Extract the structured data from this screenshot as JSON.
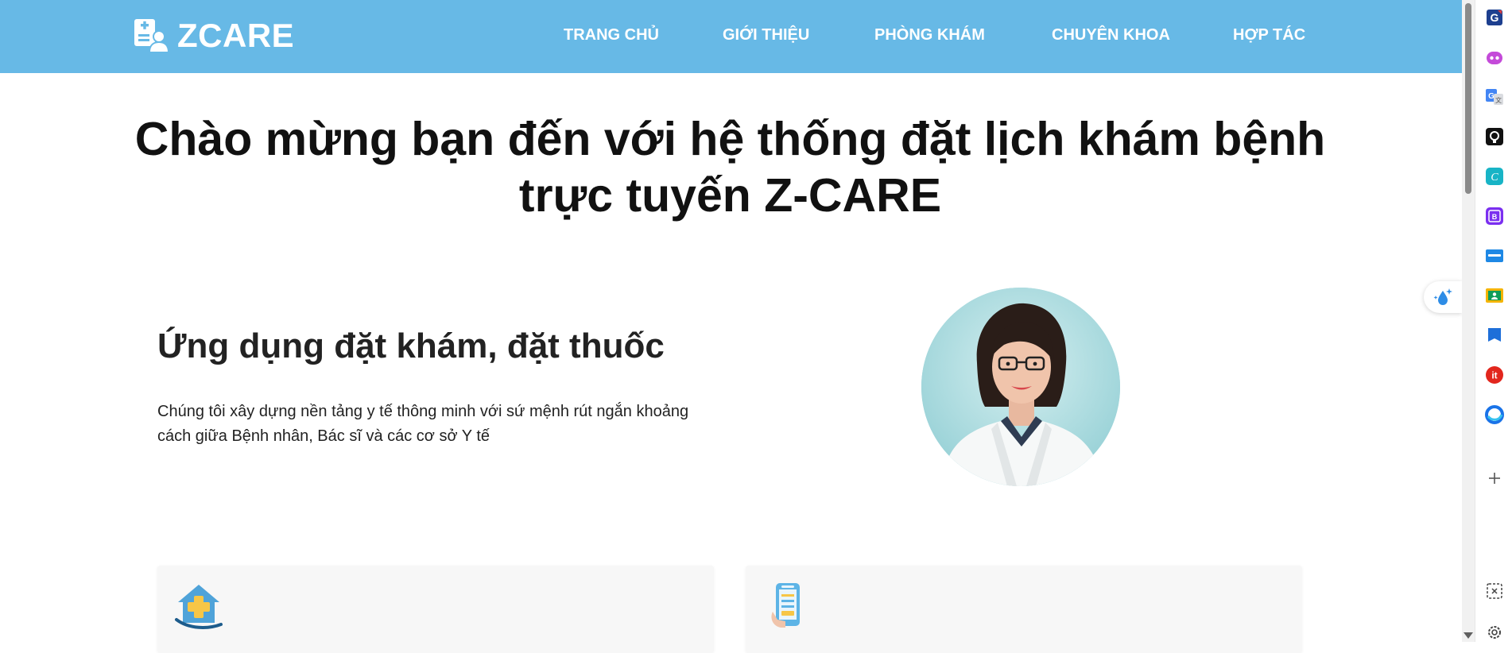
{
  "brand": {
    "name": "ZCARE"
  },
  "nav": {
    "items": [
      {
        "label": "TRANG CHỦ"
      },
      {
        "label": "GIỚI THIỆU"
      },
      {
        "label": "PHÒNG KHÁM"
      },
      {
        "label": "CHUYÊN KHOA"
      },
      {
        "label": "HỢP TÁC"
      }
    ]
  },
  "hero": {
    "title_line1": "Chào mừng bạn đến với hệ thống đặt lịch khám bệnh",
    "title_line2": "trực tuyến Z-CARE"
  },
  "section": {
    "title": "Ứng dụng đặt khám, đặt thuốc",
    "desc_line1": "Chúng tôi xây dựng nền tảng y tế thông minh với sứ mệnh rút ngắn khoảng",
    "desc_line2": "cách giữa Bệnh nhân, Bác sĩ và các cơ sở Y tế"
  },
  "cards": [
    {
      "icon": "clinic-house-icon"
    },
    {
      "icon": "test-phone-icon"
    }
  ],
  "browser_sidebar": {
    "icons": [
      "grammar-g-icon",
      "copilot-icon",
      "google-translate-icon",
      "github-icon",
      "canva-icon",
      "bootstrap-icon",
      "chatgpt-badge-icon",
      "classroom-icon",
      "flag-icon",
      "it-icon",
      "edge-icon",
      "add-icon",
      "screenshot-icon",
      "settings-icon"
    ]
  },
  "colors": {
    "header": "#67b9e6",
    "text": "#222222",
    "card_bg": "#f7f7f7"
  }
}
